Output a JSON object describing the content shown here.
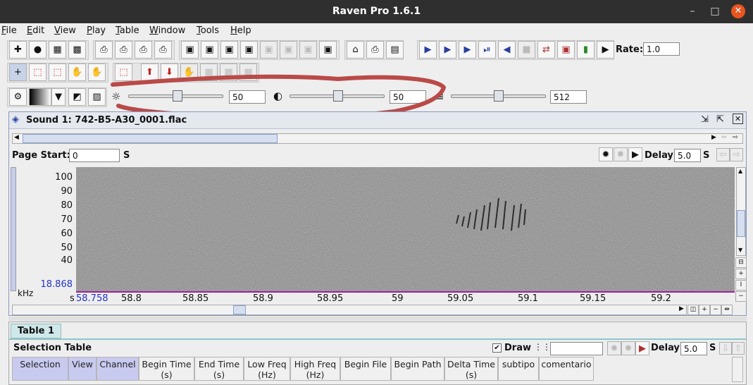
{
  "window": {
    "title": "Raven Pro 1.6.1",
    "minimize": "–",
    "maximize": "□",
    "close": "✕"
  },
  "menu": [
    {
      "label": "File",
      "mnemonic": "F",
      "rest": "ile"
    },
    {
      "label": "Edit",
      "mnemonic": "E",
      "rest": "dit"
    },
    {
      "label": "View",
      "mnemonic": "V",
      "rest": "iew"
    },
    {
      "label": "Play",
      "mnemonic": "P",
      "rest": "lay"
    },
    {
      "label": "Table",
      "mnemonic": "T",
      "rest": "able"
    },
    {
      "label": "Window",
      "mnemonic": "W",
      "rest": "indow"
    },
    {
      "label": "Tools",
      "mnemonic": "T",
      "rest": "ools"
    },
    {
      "label": "Help",
      "mnemonic": "H",
      "rest": "elp"
    }
  ],
  "toolbar": {
    "rate_label": "Rate:",
    "rate_value": "1.0"
  },
  "sliders": {
    "brightness": "50",
    "contrast": "50",
    "size": "512"
  },
  "sound_window": {
    "title": "Sound 1: 742-B5-A30_0001.flac",
    "page_start_label": "Page Start:",
    "page_start_value": "0",
    "page_start_unit": "S",
    "delay_label": "Delay:",
    "delay_value": "5.0",
    "delay_unit": "S"
  },
  "spectrogram": {
    "y_unit": "kHz",
    "y_ticks": [
      "100",
      "90",
      "80",
      "70",
      "60",
      "50",
      "40"
    ],
    "y_min": "18.868",
    "x_start_unit": "s",
    "x_start": "58.758",
    "x_ticks": [
      "58.8",
      "58.85",
      "58.9",
      "58.95",
      "59",
      "59.05",
      "59.1",
      "59.15",
      "59.2"
    ]
  },
  "table_panel": {
    "tab": "Table 1",
    "title": "Selection Table",
    "draw_label": "Draw",
    "delay_label": "Delay:",
    "delay_value": "5.0",
    "delay_unit": "S",
    "columns": [
      [
        "Selection",
        ""
      ],
      [
        "View",
        ""
      ],
      [
        "Channel",
        ""
      ],
      [
        "Begin Time",
        "(s)"
      ],
      [
        "End Time",
        "(s)"
      ],
      [
        "Low Freq",
        "(Hz)"
      ],
      [
        "High Freq",
        "(Hz)"
      ],
      [
        "Begin File",
        ""
      ],
      [
        "Begin Path",
        ""
      ],
      [
        "Delta Time",
        "(s)"
      ],
      [
        "subtipo",
        ""
      ],
      [
        "comentario",
        ""
      ]
    ]
  },
  "colors": {
    "title_bg": "#2f2f2f",
    "close_btn": "#e95420",
    "annotation": "#b94a48",
    "selected_col": "#c8cbef",
    "tab_bg": "#cfe8ea"
  }
}
